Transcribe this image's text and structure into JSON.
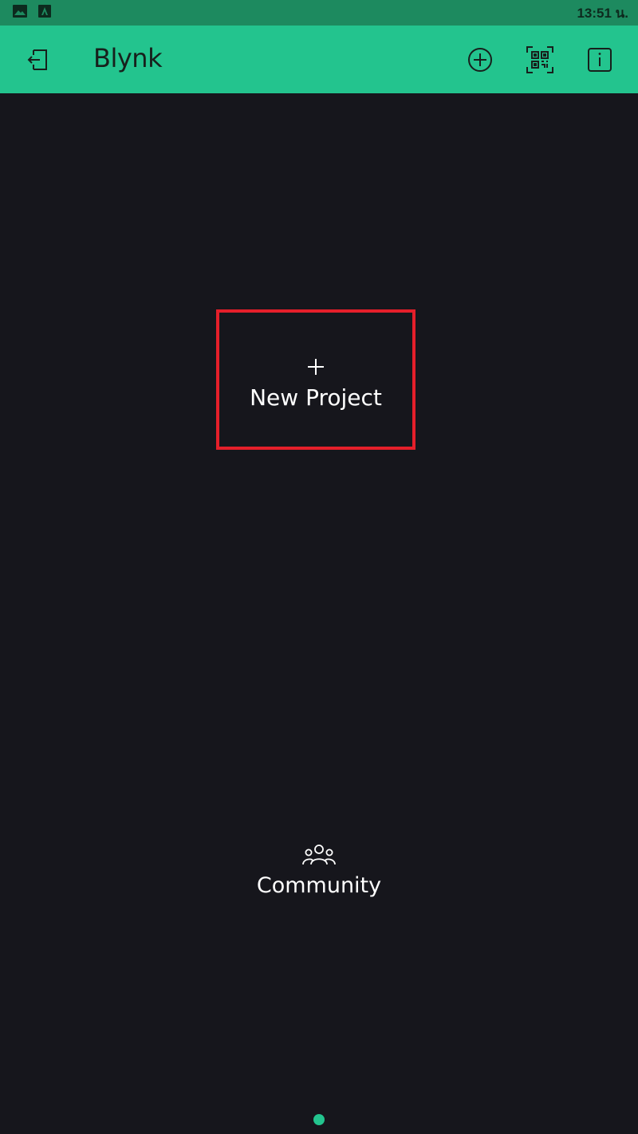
{
  "status_bar": {
    "time": "13:51 น.",
    "icons": [
      "gallery-icon",
      "app-notification-icon"
    ]
  },
  "app_bar": {
    "title": "Blynk",
    "icons": [
      "logout-icon",
      "add-circle-icon",
      "qr-code-icon",
      "info-icon"
    ],
    "background": "#23c48e"
  },
  "main": {
    "new_project": {
      "plus": "+",
      "label": "New Project"
    },
    "community": {
      "label": "Community",
      "icon": "community-icon"
    },
    "pager": {
      "pages": 1,
      "active": 1
    }
  },
  "colors": {
    "status_bar": "#1d8a5f",
    "accent": "#23c48e",
    "background": "#16161c",
    "highlight_border": "#e51f2a"
  }
}
